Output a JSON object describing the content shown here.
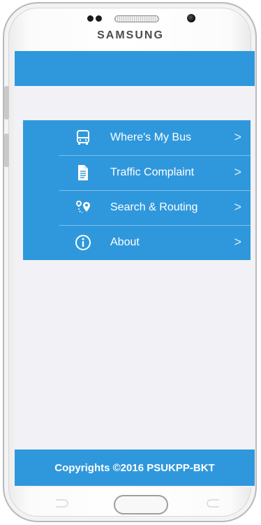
{
  "device": {
    "brand": "SAMSUNG"
  },
  "app": {
    "header_title": "",
    "menu": [
      {
        "label": "Where's My Bus",
        "icon": "bus-icon"
      },
      {
        "label": "Traffic Complaint",
        "icon": "document-icon"
      },
      {
        "label": "Search & Routing",
        "icon": "route-pin-icon"
      },
      {
        "label": "About",
        "icon": "info-icon"
      }
    ],
    "chevron": ">",
    "footer_text": "Copyrights ©2016 PSUKPP-BKT"
  },
  "colors": {
    "accent": "#2f98dc",
    "background": "#f2f1f6",
    "text_on_accent": "#ffffff"
  }
}
